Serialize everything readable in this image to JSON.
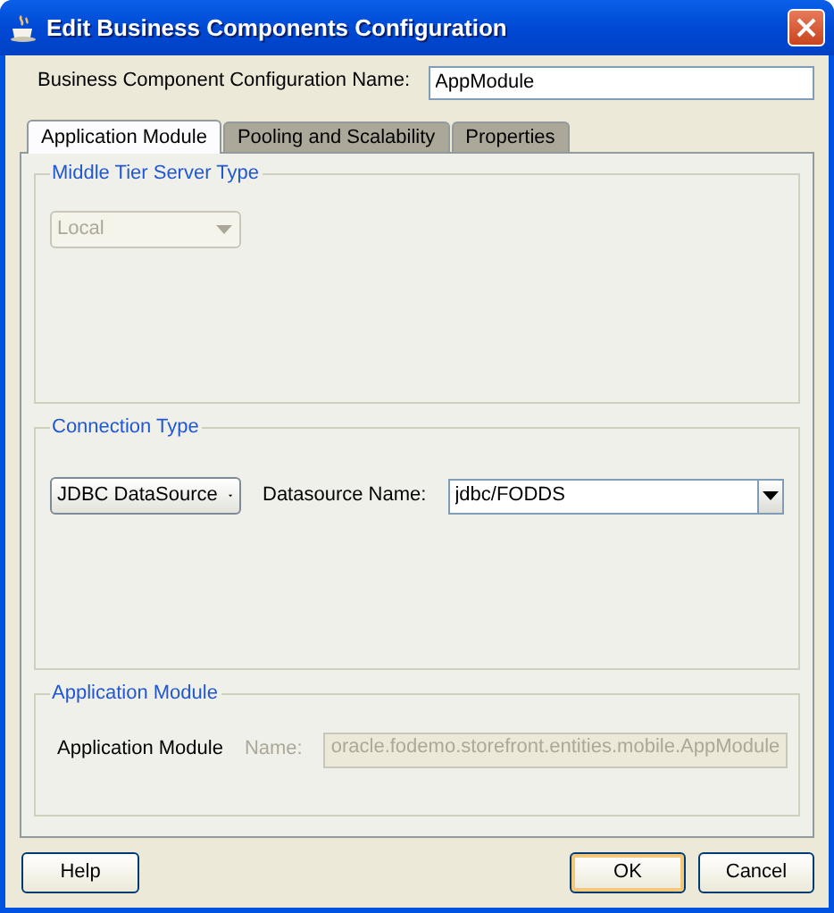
{
  "window": {
    "title": "Edit Business Components Configuration"
  },
  "config_name": {
    "label": "Business Component Configuration Name:",
    "value": "AppModule"
  },
  "tabs": [
    {
      "label": "Application Module",
      "selected": true
    },
    {
      "label": "Pooling and Scalability",
      "selected": false
    },
    {
      "label": "Properties",
      "selected": false
    }
  ],
  "groups": [
    {
      "title": "Middle Tier Server Type",
      "kind": "server",
      "combo": {
        "value": "Local",
        "disabled": true
      }
    },
    {
      "title": "Connection Type",
      "kind": "connection",
      "combo": {
        "value": "JDBC DataSource",
        "disabled": false
      },
      "field": {
        "label": "Datasource Name:",
        "value": "jdbc/FODDS"
      }
    },
    {
      "title": "Application Module",
      "kind": "module",
      "label": "Application Module",
      "field": {
        "label": "Name:",
        "value": "oracle.fodemo.storefront.entities.mobile.AppModule",
        "disabled": true
      }
    }
  ],
  "buttons": [
    {
      "label": "Help",
      "default": false
    },
    {
      "label": "OK",
      "default": true
    },
    {
      "label": "Cancel",
      "default": false
    }
  ]
}
